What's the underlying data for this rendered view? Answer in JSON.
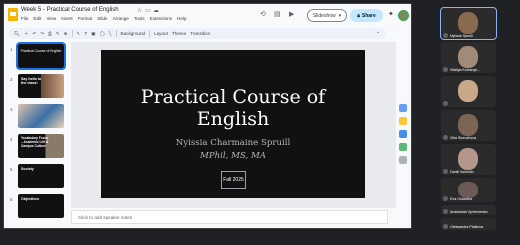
{
  "window": {
    "title": "Week 5 - Practical Course of English",
    "menu": [
      "File",
      "Edit",
      "View",
      "Insert",
      "Format",
      "Slide",
      "Arrange",
      "Tools",
      "Extensions",
      "Help"
    ],
    "slideshow_label": "Slideshow",
    "share_label": "Share"
  },
  "toolbar": {
    "items": [
      "Background",
      "Layout",
      "Theme",
      "Transition"
    ]
  },
  "thumbnails": [
    {
      "num": "1",
      "text": "Practical Course of English"
    },
    {
      "num": "2",
      "text": "Say hello to the class!"
    },
    {
      "num": "3",
      "text": ""
    },
    {
      "num": "4",
      "text": "Vocabulary Focus – Academic Life & Campus Culture"
    },
    {
      "num": "5",
      "text": "Society"
    },
    {
      "num": "6",
      "text": "Objectives"
    }
  ],
  "slide": {
    "title_line1": "Practical Course of",
    "title_line2": "English",
    "author": "Nyissia Charmaine Spruill",
    "degree": "MPhil, MS, MA",
    "term": "Fall 2025"
  },
  "notes_placeholder": "Click to add speaker notes",
  "participants": [
    {
      "name": "Nyissia Spruill",
      "color": "#8a6a4f"
    },
    {
      "name": "Vitaliya Kolesnyk...",
      "color": "#a08a78"
    },
    {
      "name": "",
      "color": "#c9a88a"
    },
    {
      "name": "Vika Storozhova",
      "color": "#7d6555"
    },
    {
      "name": "Daniil Voloshin",
      "color": "#b4978a"
    },
    {
      "name": "Eva Oslavska",
      "color": "#6b5a55"
    },
    {
      "name": "Anastasiia Vyrhemenko",
      "color": "#c4a690"
    },
    {
      "name": "Oleksandra Piatkova",
      "color": "#9b7e70"
    }
  ],
  "colors": {
    "accent": "#1a73e8",
    "share_bg": "#c2e7ff",
    "slide_bg": "#111111"
  }
}
